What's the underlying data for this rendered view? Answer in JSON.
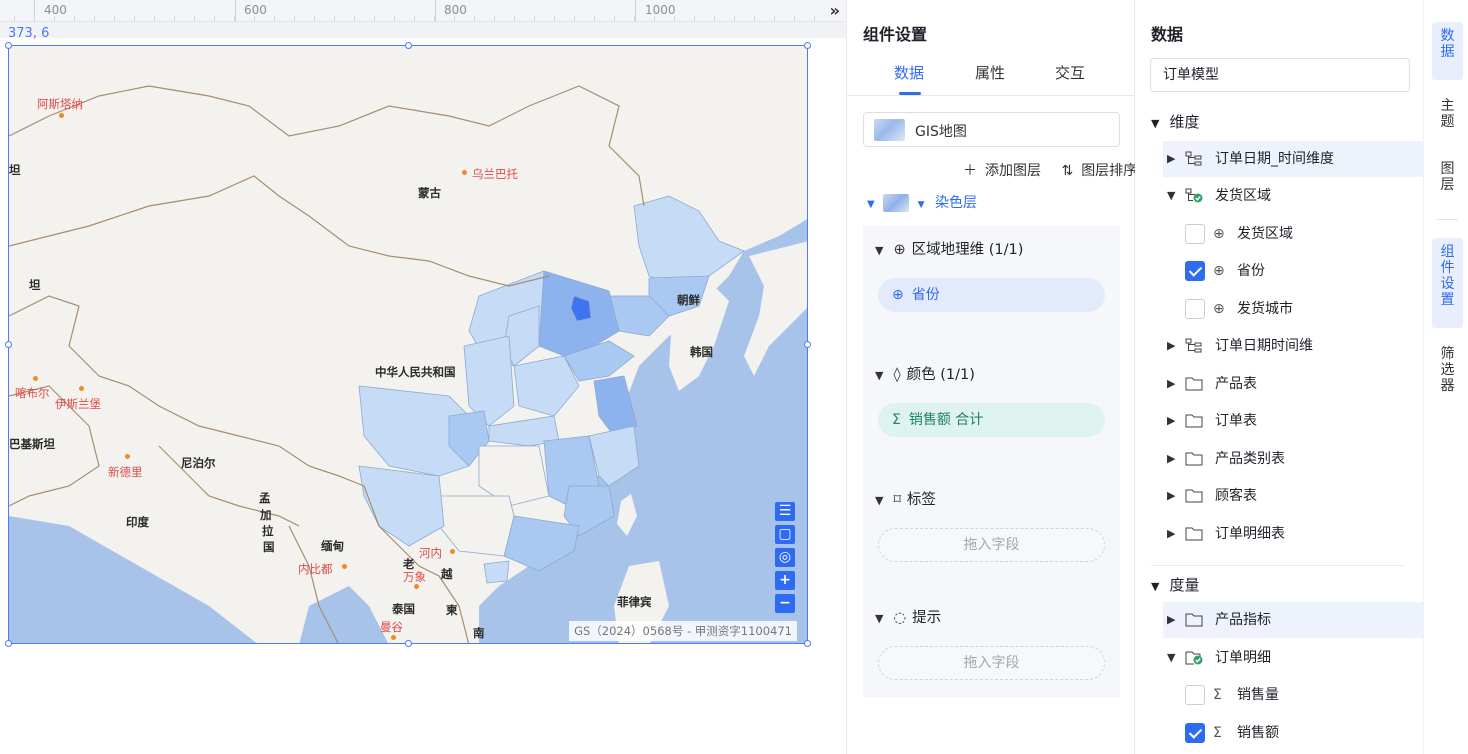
{
  "ruler": {
    "ticks": [
      "400",
      "600",
      "800",
      "1000"
    ],
    "collapse_icon": "double-chevron-right"
  },
  "canvas": {
    "coord_readout": "373, 6"
  },
  "map": {
    "regions": [
      "蒙古",
      "中华人民共和国",
      "朝鲜",
      "韩国",
      "尼泊尔",
      "印度",
      "缅甸",
      "泰国",
      "菲律宾",
      "越",
      "老",
      "孟",
      "加",
      "拉",
      "国",
      "柬",
      "南",
      "坦",
      "巴基斯坦",
      "坦"
    ],
    "cities": [
      "阿斯塔纳",
      "乌兰巴托",
      "喀布尔",
      "伊斯兰堡",
      "新德里",
      "河内",
      "万象",
      "内比都",
      "曼谷"
    ],
    "copyright": "GS（2024）0568号 - 甲测资字1100471",
    "controls": [
      "legend-icon",
      "fit-bounds-icon",
      "locate-icon",
      "zoom-in-icon",
      "zoom-out-icon"
    ],
    "colors": {
      "sea": "#a7c3ea",
      "land": "#f3f2ee",
      "china_base": "#f3f2ee",
      "shade_light": "#c6dcf6",
      "shade_mid": "#a9c9f3",
      "shade_dark": "#8db3ef",
      "shade_darkest": "#3f73f2",
      "selection": "#4d7cf4"
    }
  },
  "settings": {
    "title": "组件设置",
    "tabs": [
      "数据",
      "属性",
      "交互"
    ],
    "active_tab": "数据",
    "layer_select": "GIS地图",
    "add_layer": "添加图层",
    "sort_layer": "图层排序",
    "dye_layer": "染色层",
    "sections": {
      "geo": {
        "label": "区域地理维 (1/1)",
        "pill": "省份"
      },
      "color": {
        "label": "颜色 (1/1)",
        "pill": "销售额 合计"
      },
      "label": {
        "label": "标签",
        "drop": "拖入字段"
      },
      "tooltip": {
        "label": "提示",
        "drop": "拖入字段"
      }
    }
  },
  "data_panel": {
    "title": "数据",
    "model": "订单模型",
    "dimension_label": "维度",
    "dimensions": [
      {
        "label": "订单日期_时间维度",
        "icon": "hierarchy-icon",
        "expanded": false,
        "highlight": true
      },
      {
        "label": "发货区域",
        "icon": "hierarchy-check-icon",
        "expanded": true,
        "highlight": false
      },
      {
        "label": "订单日期时间维",
        "icon": "hierarchy-icon",
        "expanded": false,
        "highlight": false
      },
      {
        "label": "产品表",
        "icon": "folder-icon",
        "expanded": false,
        "highlight": false
      },
      {
        "label": "订单表",
        "icon": "folder-icon",
        "expanded": false,
        "highlight": false
      },
      {
        "label": "产品类别表",
        "icon": "folder-icon",
        "expanded": false,
        "highlight": false
      },
      {
        "label": "顾客表",
        "icon": "folder-icon",
        "expanded": false,
        "highlight": false
      },
      {
        "label": "订单明细表",
        "icon": "folder-icon",
        "expanded": false,
        "highlight": false
      }
    ],
    "region_fields": [
      {
        "label": "发货区域",
        "checked": false
      },
      {
        "label": "省份",
        "checked": true
      },
      {
        "label": "发货城市",
        "checked": false
      }
    ],
    "measure_label": "度量",
    "measures": [
      {
        "label": "产品指标",
        "icon": "folder-icon",
        "expanded": false,
        "highlight": true
      },
      {
        "label": "订单明细",
        "icon": "folder-check-icon",
        "expanded": true,
        "highlight": false
      }
    ],
    "measure_fields": [
      {
        "label": "销售量",
        "checked": false
      },
      {
        "label": "销售额",
        "checked": true
      }
    ]
  },
  "side_tabs": [
    "数据",
    "主题",
    "图层",
    "组件设置",
    "筛选器"
  ],
  "side_active": [
    "数据",
    "组件设置"
  ]
}
